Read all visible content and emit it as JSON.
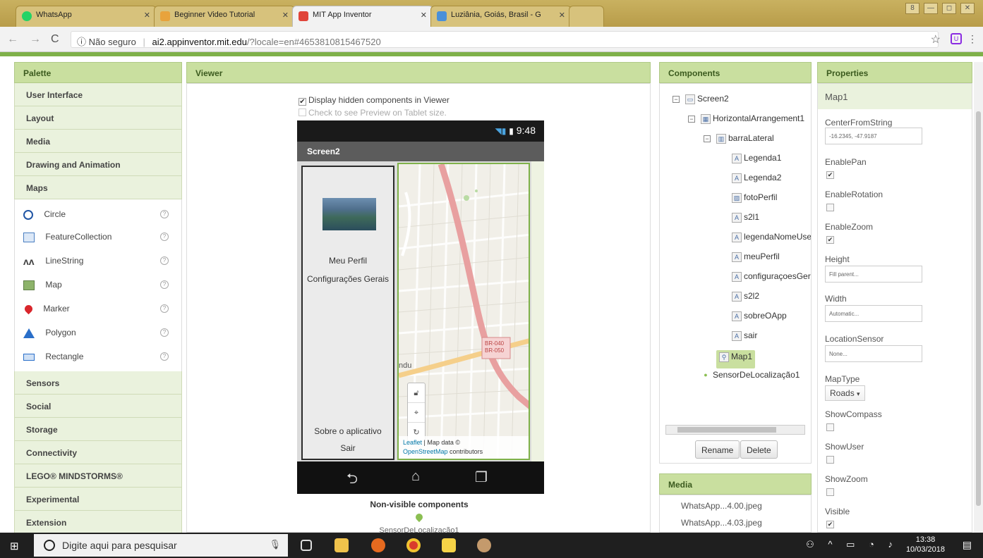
{
  "browser": {
    "tabs": [
      {
        "title": "WhatsApp",
        "color": "#25d366"
      },
      {
        "title": "Beginner Video Tutorial",
        "color": "#e8a33c"
      },
      {
        "title": "MIT App Inventor",
        "color": "#e0453a"
      },
      {
        "title": "Luziânia, Goiás, Brasil - G",
        "color": "#4a90d9"
      }
    ],
    "insecure_label": "Não seguro",
    "url_host": "ai2.appinventor.mit.edu",
    "url_path": "/?locale=en#4653810815467520"
  },
  "palette": {
    "header": "Palette",
    "categories_top": [
      "User Interface",
      "Layout",
      "Media",
      "Drawing and Animation",
      "Maps"
    ],
    "maps_items": [
      {
        "label": "Circle",
        "icon": "circle-icon"
      },
      {
        "label": "FeatureCollection",
        "icon": "feature-collection-icon"
      },
      {
        "label": "LineString",
        "icon": "linestring-icon"
      },
      {
        "label": "Map",
        "icon": "map-icon"
      },
      {
        "label": "Marker",
        "icon": "marker-icon"
      },
      {
        "label": "Polygon",
        "icon": "polygon-icon"
      },
      {
        "label": "Rectangle",
        "icon": "rectangle-icon"
      }
    ],
    "categories_bottom": [
      "Sensors",
      "Social",
      "Storage",
      "Connectivity",
      "LEGO® MINDSTORMS®",
      "Experimental",
      "Extension"
    ]
  },
  "viewer": {
    "header": "Viewer",
    "display_hidden": "Display hidden components in Viewer",
    "tablet_preview": "Check to see Preview on Tablet size.",
    "status_time": "9:48",
    "screen_title": "Screen2",
    "side_profile": "Meu Perfil",
    "side_settings": "Configurações Gerais",
    "side_about": "Sobre o aplicativo",
    "side_exit": "Sair",
    "map_road_label": "BR-040\nBR-050",
    "map_place": "ndu",
    "attrib_leaflet": "Leaflet",
    "attrib_mapdata": " | Map data ©",
    "attrib_osm": "OpenStreetMap",
    "attrib_contrib": " contributors",
    "nonvisible_label": "Non-visible components",
    "nonvisible_item": "SensorDeLocalização1"
  },
  "components": {
    "header": "Components",
    "tree": [
      {
        "label": "Screen2",
        "depth": 0,
        "toggle": "⊟"
      },
      {
        "label": "HorizontalArrangement1",
        "depth": 1,
        "toggle": "⊟"
      },
      {
        "label": "barraLateral",
        "depth": 2,
        "toggle": "⊟"
      },
      {
        "label": "Legenda1",
        "depth": 3
      },
      {
        "label": "Legenda2",
        "depth": 3
      },
      {
        "label": "fotoPerfil",
        "depth": 3
      },
      {
        "label": "s2l1",
        "depth": 3
      },
      {
        "label": "legendaNomeUser",
        "depth": 3
      },
      {
        "label": "meuPerfil",
        "depth": 3
      },
      {
        "label": "configuraçoesGerai",
        "depth": 3
      },
      {
        "label": "s2l2",
        "depth": 3
      },
      {
        "label": "sobreOApp",
        "depth": 3
      },
      {
        "label": "sair",
        "depth": 3
      },
      {
        "label": "Map1",
        "depth": 2,
        "selected": true
      },
      {
        "label": "SensorDeLocalização1",
        "depth": 1
      }
    ],
    "rename": "Rename",
    "delete": "Delete"
  },
  "media": {
    "header": "Media",
    "items": [
      "WhatsApp...4.00.jpeg",
      "WhatsApp...4.03.jpeg"
    ]
  },
  "properties": {
    "header": "Properties",
    "component": "Map1",
    "center_label": "CenterFromString",
    "center_value": "-16.2345, -47.9187",
    "enablepan": "EnablePan",
    "enablerotation": "EnableRotation",
    "enablezoom": "EnableZoom",
    "height_label": "Height",
    "height_value": "Fill parent...",
    "width_label": "Width",
    "width_value": "Automatic...",
    "locsensor_label": "LocationSensor",
    "locsensor_value": "None...",
    "maptype_label": "MapType",
    "maptype_value": "Roads",
    "showcompass": "ShowCompass",
    "showuser": "ShowUser",
    "showzoom": "ShowZoom",
    "visible": "Visible"
  },
  "taskbar": {
    "search_placeholder": "Digite aqui para pesquisar",
    "time": "13:38",
    "date": "10/03/2018"
  }
}
